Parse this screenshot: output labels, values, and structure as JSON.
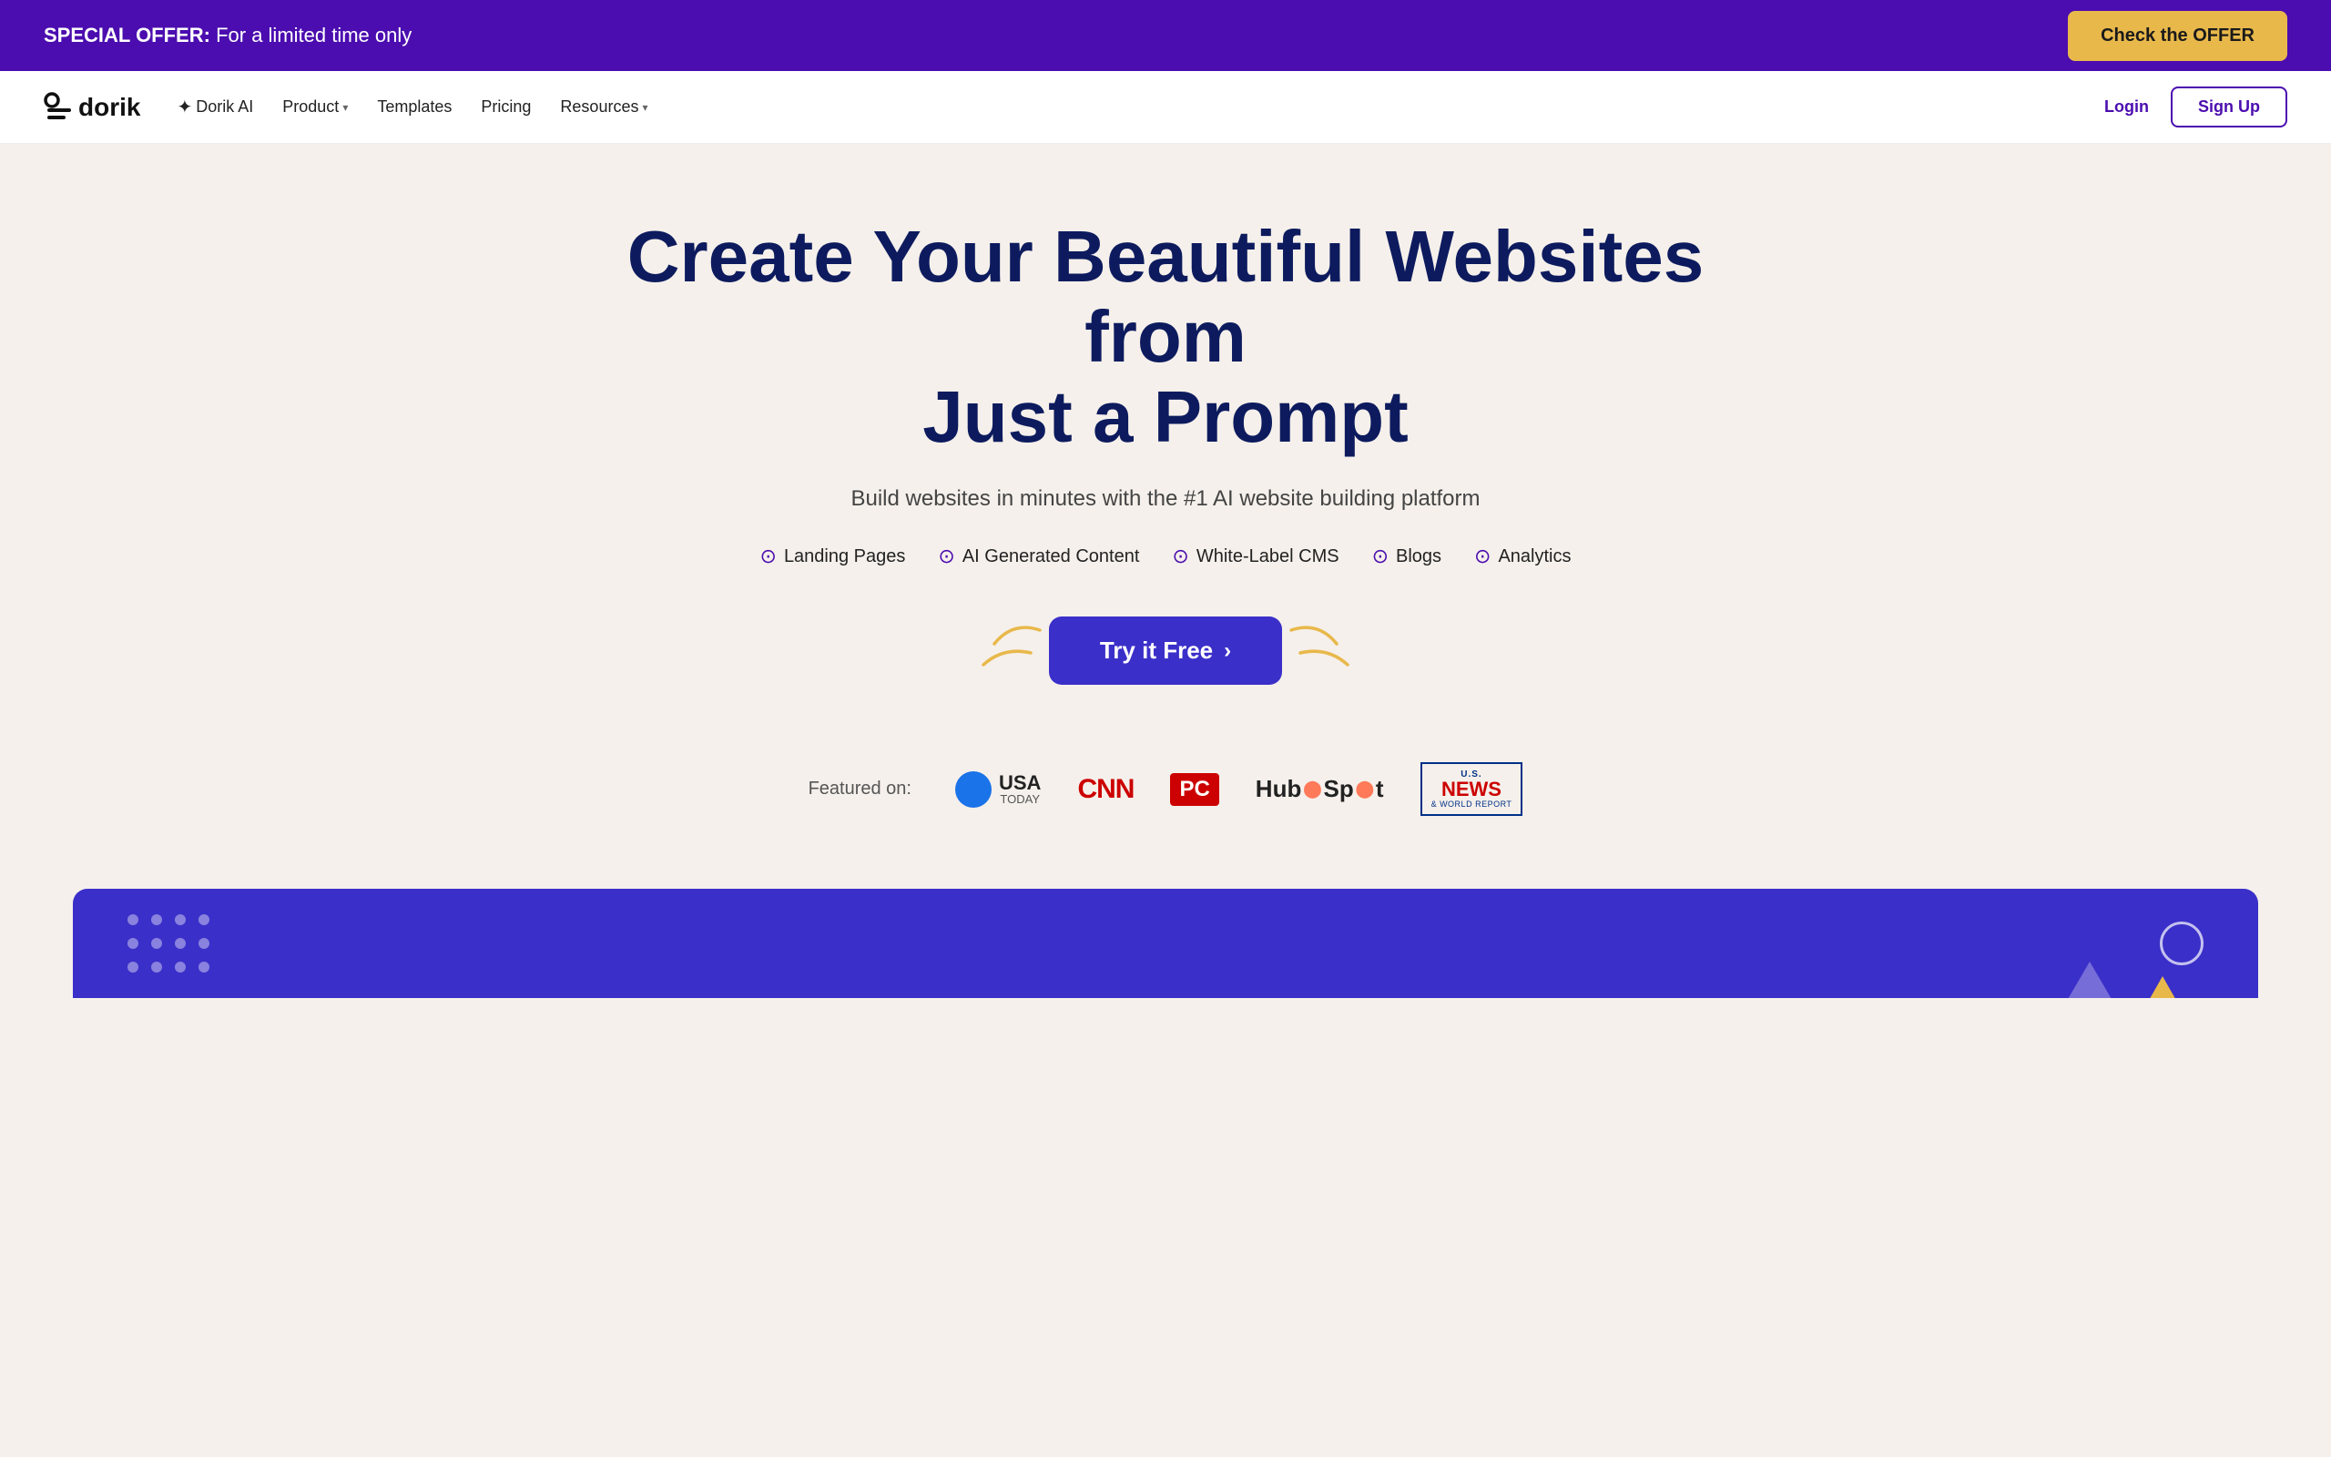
{
  "banner": {
    "text_bold": "SPECIAL OFFER:",
    "text_normal": " For a limited time only",
    "cta_label": "Check the OFFER"
  },
  "nav": {
    "logo_text": "dorik",
    "links": [
      {
        "label": "Dorik AI",
        "has_chevron": false,
        "has_sparkle": true
      },
      {
        "label": "Product",
        "has_chevron": true
      },
      {
        "label": "Templates",
        "has_chevron": false
      },
      {
        "label": "Pricing",
        "has_chevron": false
      },
      {
        "label": "Resources",
        "has_chevron": true
      }
    ],
    "login_label": "Login",
    "signup_label": "Sign Up"
  },
  "hero": {
    "title_line1": "Create Your Beautiful Websites from",
    "title_line2": "Just a Prompt",
    "subtitle": "Build websites in minutes with the #1 AI website building platform",
    "features": [
      "Landing Pages",
      "AI Generated Content",
      "White-Label CMS",
      "Blogs",
      "Analytics"
    ],
    "cta_label": "Try it Free",
    "cta_arrow": "›"
  },
  "featured": {
    "label": "Featured on:",
    "logos": [
      "USA TODAY",
      "CNN",
      "PC",
      "HubSpot",
      "U.S.News"
    ]
  }
}
